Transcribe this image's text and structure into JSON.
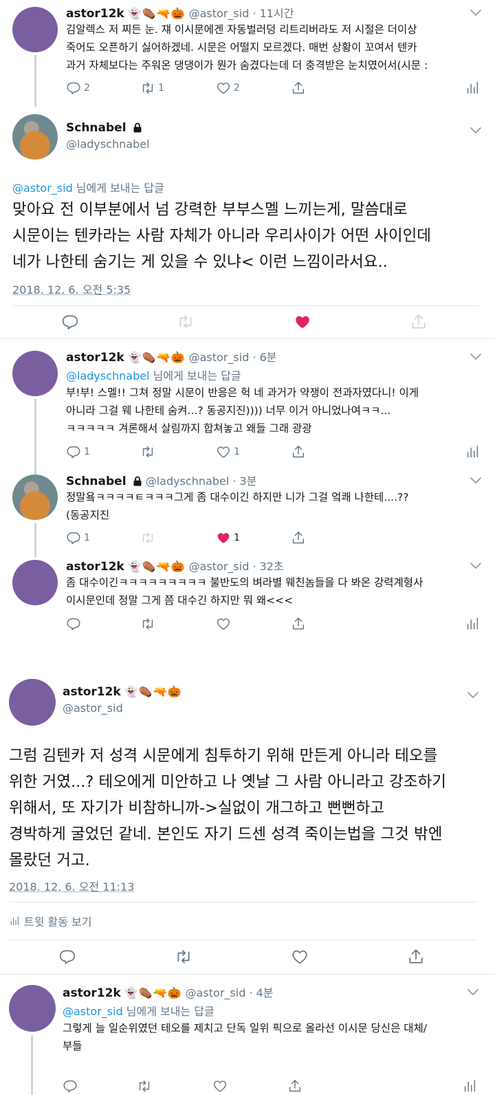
{
  "emoji": "👻⚰️🔫🎃",
  "tweet1": {
    "name": "astor12k",
    "handle": "@astor_sid",
    "time": "11시간",
    "line1": "김알렉스 저 찌든 눈. 쟤 이시문에겐 자동벌러덩 리트리버라도 저 시절은 더이상",
    "line2": "죽어도 오픈하기 싫어하겠네. 시문은 어떨지 모르겠다. 매번 상황이 꼬여서 텐카",
    "line3": "과거 자체보다는 주워온 댕댕이가 뭔가 숨겼다는데 더 충격받은 눈치였어서(시문 :",
    "replies": "2",
    "retweets": "1",
    "likes": "2"
  },
  "tweet2": {
    "name": "Schnabel",
    "handle": "@ladyschnabel",
    "replying_prefix": "@astor_sid",
    "replying_suffix": " 님에게 보내는 답글",
    "line1": "맞아요 전 이부분에서 넘 강력한 부부스멜 느끼는게, 말씀대로",
    "line2": "시문이는 텐카라는 사람 자체가 아니라 우리사이가 어떤 사이인데",
    "line3": "네가 나한테 숨기는 게 있을 수 있냐< 이런 느낌이라서요..",
    "date": "2018. 12. 6. 오전 5:35"
  },
  "tweet3": {
    "name": "astor12k",
    "handle": "@astor_sid",
    "time": "6분",
    "replying_prefix": "@ladyschnabel",
    "replying_suffix": " 님에게 보내는 답글",
    "line1": "부!부! 스멜!! 그쳐 정말 시문이 반응은 헉 네 과거가 약쟁이 전과자였다니! 이게",
    "line2": "아니라 그걸 웨 나한테 숨켜...? 동공지진)))) 너무 이거 아니었나여ㅋㅋ...",
    "line3": "ㅋㅋㅋㅋㅋ 겨론해서 살림까지 합쳐놓고 왜들 그래 광광",
    "replies": "1",
    "likes": "1"
  },
  "tweet4": {
    "name": "Schnabel",
    "handle": "@ladyschnabel",
    "time": "3분",
    "line1": "정말욬ㅋㅋㅋㅋㅌㅋㅋㅋ그게 좀 대수이긴 하지만 니가 그걸 엌쾌 나한테....??",
    "line2": "(동공지진",
    "replies": "1",
    "likes": "1"
  },
  "tweet5": {
    "name": "astor12k",
    "handle": "@astor_sid",
    "time": "32초",
    "line1": "좀 대수이긴ㅋㅋㅋㅋㅋㅋㅋㅋㅋ 불반도의 벼라별 웨친놈들을 다 봐온 강력계형사",
    "line2": "이시문인데 정말 그게 쯤 대수긴 하지만 뭐 왜<<<"
  },
  "tweet6": {
    "name": "astor12k",
    "handle": "@astor_sid",
    "line1": "그럼 김텐카 저 성격 시문에게 침투하기 위해 만든게 아니라 테오를",
    "line2": "위한 거였...? 테오에게 미안하고 나 옛날 그 사람 아니라고 강조하기",
    "line3": "위해서, 또 자기가 비참하니까->실없이 개그하고 뻔뻔하고",
    "line4": "경박하게 굴었던 같네. 본인도 자기 드센 성격 죽이는법을 그것 밖엔",
    "line5": "몰랐던 거고.",
    "date": "2018. 12. 6. 오전 11:13",
    "activity": "트윗 활동 보기"
  },
  "tweet7": {
    "name": "astor12k",
    "handle": "@astor_sid",
    "time": "4분",
    "replying_prefix": "@astor_sid",
    "replying_suffix": " 님에게 보내는 답글",
    "line1": "그렇게 늘 일순위였던 테오를 제치고 단독 일위 픽으로 올라선 이시문 당신은 대체/",
    "line2": "부들"
  },
  "colors": {
    "accent": "#1b95e0",
    "like": "#e0245e",
    "avatar": "#7a5fa0",
    "muted": "#657786"
  }
}
